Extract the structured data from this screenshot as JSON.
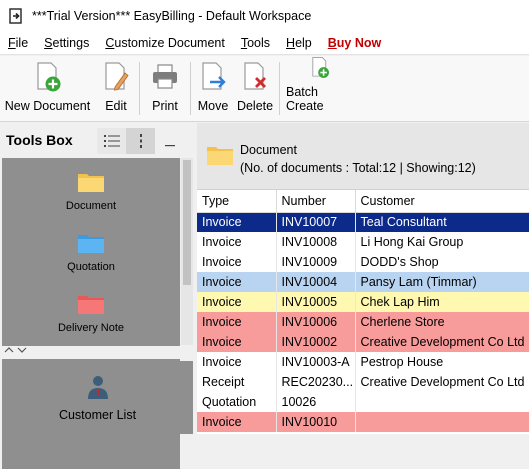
{
  "window": {
    "title": "***Trial Version*** EasyBilling - Default Workspace"
  },
  "menu": [
    {
      "key": "file",
      "label": "File",
      "u": "F",
      "rest": "ile"
    },
    {
      "key": "settings",
      "label": "Settings",
      "u": "S",
      "rest": "ettings"
    },
    {
      "key": "customize",
      "label": "Customize Document",
      "u": "C",
      "rest": "ustomize Document"
    },
    {
      "key": "tools",
      "label": "Tools",
      "u": "T",
      "rest": "ools"
    },
    {
      "key": "help",
      "label": "Help",
      "u": "H",
      "rest": "elp"
    },
    {
      "key": "buy",
      "label": "Buy Now",
      "u": "B",
      "rest": "uy Now"
    }
  ],
  "toolbar": {
    "new_document": "New Document",
    "edit": "Edit",
    "print": "Print",
    "move": "Move",
    "delete": "Delete",
    "batch_create": "Batch Create"
  },
  "toolsbox": {
    "title": "Tools Box",
    "items": [
      "Document",
      "Quotation",
      "Delivery Note"
    ],
    "customer_list": "Customer List"
  },
  "documents": {
    "title": "Document",
    "summary": "(No. of documents : Total:12 | Showing:12)",
    "columns": [
      "Type",
      "Number",
      "Customer"
    ],
    "rows": [
      {
        "type": "Invoice",
        "number": "INV10007",
        "customer": "Teal Consultant",
        "style": "selected"
      },
      {
        "type": "Invoice",
        "number": "INV10008",
        "customer": "Li Hong Kai Group",
        "style": "white"
      },
      {
        "type": "Invoice",
        "number": "INV10009",
        "customer": "DODD's Shop",
        "style": "white"
      },
      {
        "type": "Invoice",
        "number": "INV10004",
        "customer": "Pansy Lam (Timmar)",
        "style": "blue"
      },
      {
        "type": "Invoice",
        "number": "INV10005",
        "customer": "Chek Lap Him",
        "style": "yellow"
      },
      {
        "type": "Invoice",
        "number": "INV10006",
        "customer": "Cherlene Store",
        "style": "pink"
      },
      {
        "type": "Invoice",
        "number": "INV10002",
        "customer": "Creative Development Co Ltd",
        "style": "pink"
      },
      {
        "type": "Invoice",
        "number": "INV10003-A",
        "customer": "Pestrop House",
        "style": "white"
      },
      {
        "type": "Receipt",
        "number": "REC20230...",
        "customer": "Creative Development Co Ltd",
        "style": "white"
      },
      {
        "type": "Quotation",
        "number": "10026",
        "customer": "",
        "style": "white"
      },
      {
        "type": "Invoice",
        "number": "INV10010",
        "customer": "",
        "style": "pink"
      }
    ]
  }
}
